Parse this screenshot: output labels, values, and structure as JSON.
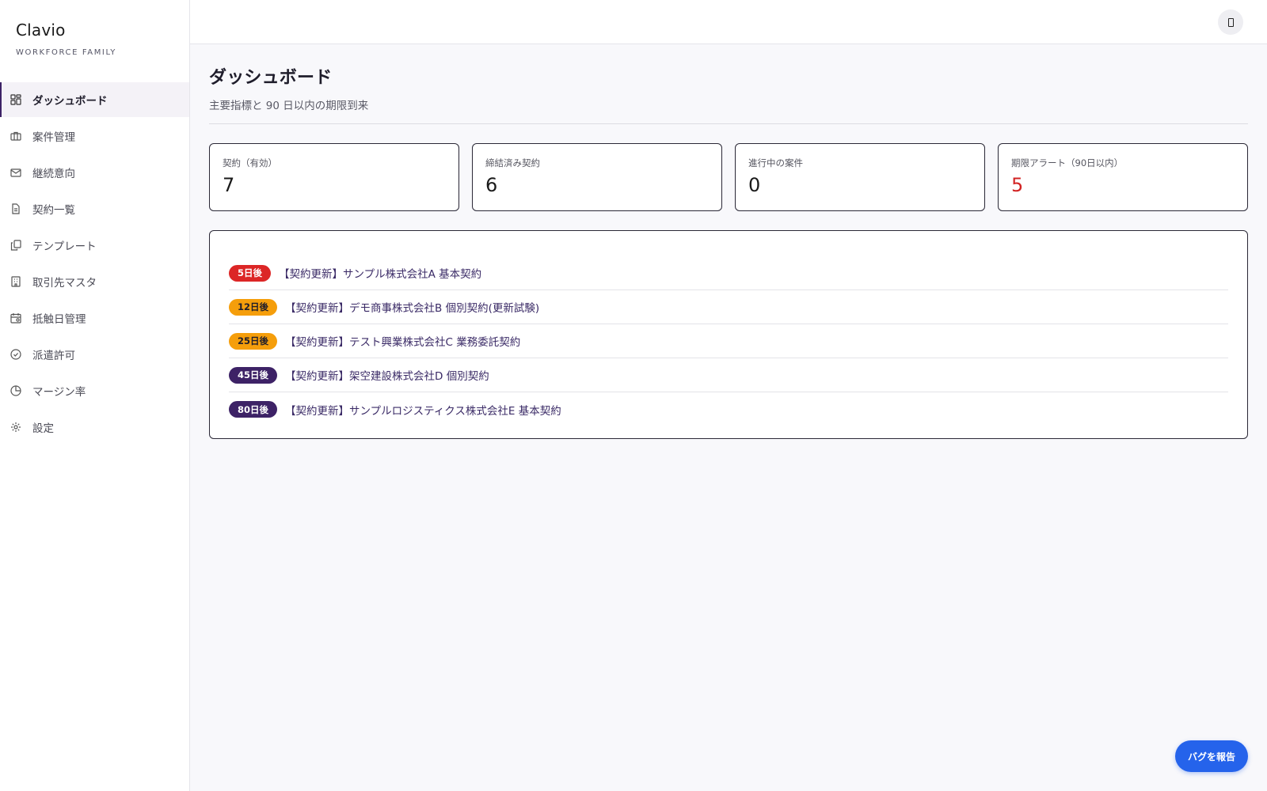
{
  "brand": {
    "name": "Clavio",
    "subtitle": "WORKFORCE FAMILY"
  },
  "colors": {
    "accent": "#3d2266",
    "alert_value": "#d22323",
    "report_button": "#2563eb"
  },
  "sidebar": {
    "items": [
      {
        "label": "ダッシュボード",
        "icon": "dashboard-icon",
        "active": true
      },
      {
        "label": "案件管理",
        "icon": "briefcase-icon",
        "active": false
      },
      {
        "label": "継続意向",
        "icon": "mail-icon",
        "active": false
      },
      {
        "label": "契約一覧",
        "icon": "document-icon",
        "active": false
      },
      {
        "label": "テンプレート",
        "icon": "copy-icon",
        "active": false
      },
      {
        "label": "取引先マスタ",
        "icon": "building-icon",
        "active": false
      },
      {
        "label": "抵触日管理",
        "icon": "calendar-icon",
        "active": false
      },
      {
        "label": "派遣許可",
        "icon": "check-circle-icon",
        "active": false
      },
      {
        "label": "マージン率",
        "icon": "pie-chart-icon",
        "active": false
      },
      {
        "label": "設定",
        "icon": "gear-icon",
        "active": false
      }
    ]
  },
  "header": {
    "title": "ダッシュボード",
    "subtitle": "主要指標と 90 日以内の期限到来"
  },
  "stats": [
    {
      "label": "契約（有効）",
      "value": "7",
      "alert": false
    },
    {
      "label": "締結済み契約",
      "value": "6",
      "alert": false
    },
    {
      "label": "進行中の案件",
      "value": "0",
      "alert": false
    },
    {
      "label": "期限アラート（90日以内）",
      "value": "5",
      "alert": true
    }
  ],
  "deadlines": [
    {
      "badge": "5日後",
      "badge_bg": "#dc2626",
      "badge_fg": "#ffffff",
      "title": "【契約更新】サンプル株式会社A 基本契約"
    },
    {
      "badge": "12日後",
      "badge_bg": "#f59e0b",
      "badge_fg": "#1f1d2b",
      "title": "【契約更新】デモ商事株式会社B 個別契約(更新試験)"
    },
    {
      "badge": "25日後",
      "badge_bg": "#f59e0b",
      "badge_fg": "#1f1d2b",
      "title": "【契約更新】テスト興業株式会社C 業務委託契約"
    },
    {
      "badge": "45日後",
      "badge_bg": "#3d2266",
      "badge_fg": "#ffffff",
      "title": "【契約更新】架空建設株式会社D 個別契約"
    },
    {
      "badge": "80日後",
      "badge_bg": "#3d2266",
      "badge_fg": "#ffffff",
      "title": "【契約更新】サンプルロジスティクス株式会社E 基本契約"
    }
  ],
  "report_button": {
    "label": "バグを報告"
  }
}
